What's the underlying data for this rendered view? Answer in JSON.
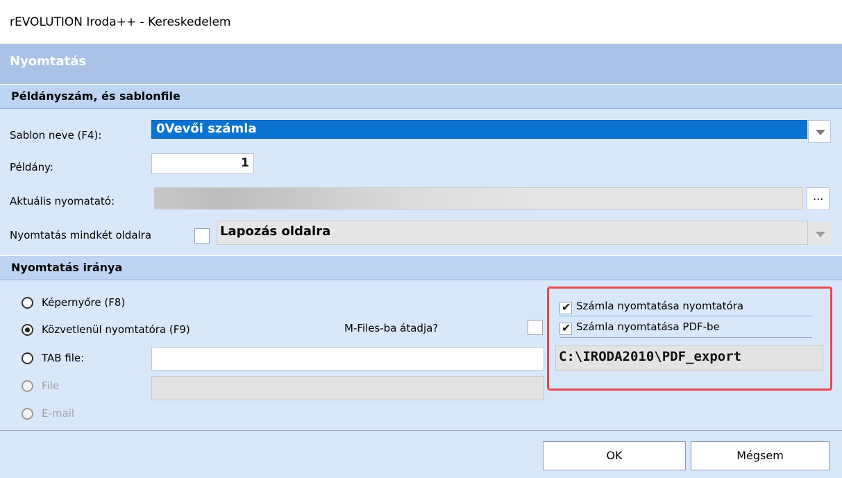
{
  "window": {
    "title": "rEVOLUTION Iroda++  - Kereskedelem"
  },
  "dialog": {
    "header": "Nyomtatás",
    "section1": {
      "title": "Példányszám, és sablonfile",
      "template_label": "Sablon neve (F4):",
      "template_value": "0Vevői számla",
      "copies_label": "Példány:",
      "copies_value": "1",
      "printer_label": "Aktuális nyomatató:",
      "printer_button": "...",
      "duplex_label": "Nyomtatás mindkét oldalra",
      "duplex_mode": "Lapozás oldalra"
    },
    "section2": {
      "title": "Nyomtatás iránya",
      "options": {
        "screen": "Képernyőre (F8)",
        "printer": "Közvetlenül nyomtatóra (F9)",
        "tab": "TAB file:",
        "file": "File",
        "email": "E-mail"
      },
      "mfiles_label": "M-Files-ba átadja?",
      "print_to_printer": "Számla nyomtatása nyomtatóra",
      "print_to_pdf": "Számla nyomtatása PDF-be",
      "pdf_path": "C:\\IRODA2010\\PDF_export"
    },
    "buttons": {
      "ok": "OK",
      "cancel": "Mégsem"
    }
  }
}
